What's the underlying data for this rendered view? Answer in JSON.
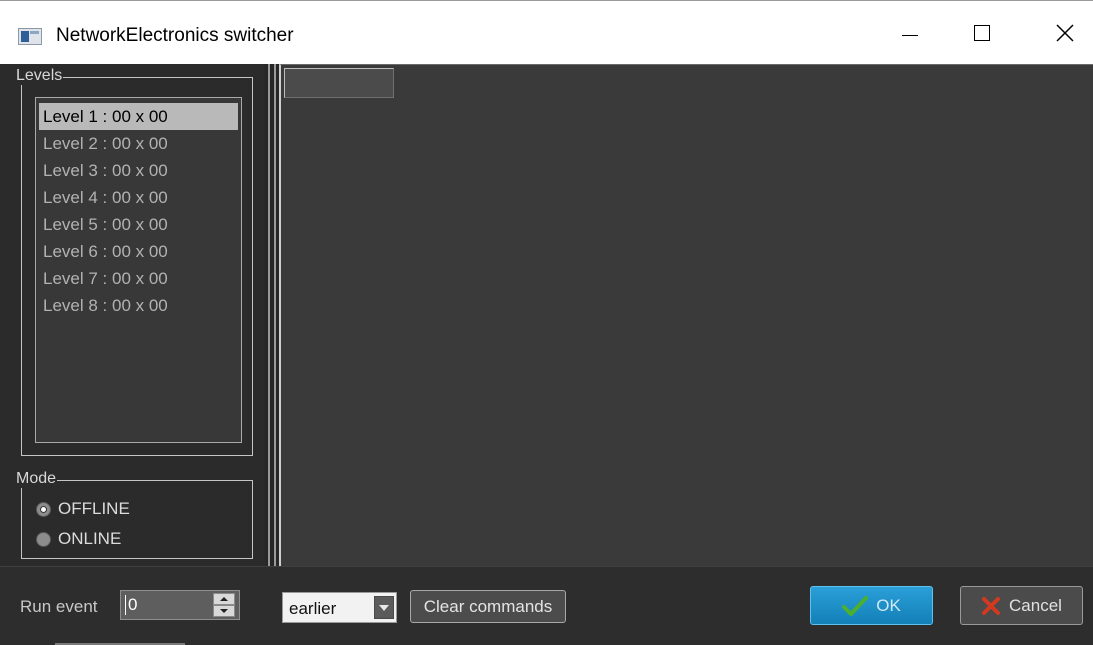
{
  "window": {
    "title": "NetworkElectronics switcher",
    "icons": {
      "app": "app-window-icon",
      "minimize": "minimize-icon",
      "maximize": "maximize-icon",
      "close": "close-icon"
    },
    "close_glyph": "✕"
  },
  "levels": {
    "group_title": "Levels",
    "items": [
      {
        "label": "Level 1 : 00 x 00",
        "selected": true
      },
      {
        "label": "Level 2 : 00 x 00",
        "selected": false
      },
      {
        "label": "Level 3 : 00 x 00",
        "selected": false
      },
      {
        "label": "Level 4 : 00 x 00",
        "selected": false
      },
      {
        "label": "Level 5 : 00 x 00",
        "selected": false
      },
      {
        "label": "Level 6 : 00 x 00",
        "selected": false
      },
      {
        "label": "Level 7 : 00 x 00",
        "selected": false
      },
      {
        "label": "Level 8 : 00 x 00",
        "selected": false
      }
    ]
  },
  "mode": {
    "group_title": "Mode",
    "options": [
      {
        "label": "OFFLINE",
        "checked": true
      },
      {
        "label": "ONLINE",
        "checked": false
      }
    ]
  },
  "bottom": {
    "run_event_label": "Run event",
    "run_event_value": "0",
    "order_value": "earlier",
    "clear_label": "Clear commands",
    "ok_label": "OK",
    "cancel_label": "Cancel"
  },
  "colors": {
    "ok_accent": "#1a8fcb",
    "ok_check": "#4caf2e",
    "cancel_x": "#d23a1f",
    "selection": "#b9b9b9"
  }
}
